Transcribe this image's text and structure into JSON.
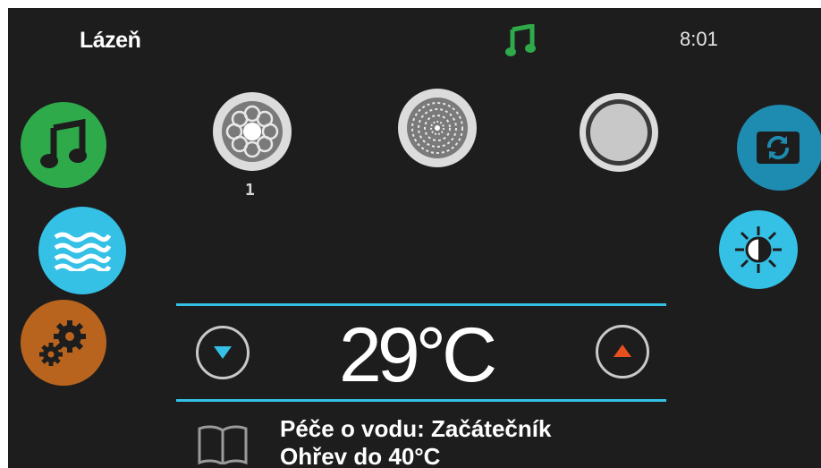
{
  "header": {
    "title": "Lázeň",
    "time": "8:01",
    "status_icon": "music-note-icon",
    "status_color": "#2eaa4a"
  },
  "left_menu": [
    {
      "icon": "music-icon",
      "color": "#2eaa4a"
    },
    {
      "icon": "water-waves-icon",
      "color": "#35c0e6"
    },
    {
      "icon": "gears-icon",
      "color": "#b8641e"
    }
  ],
  "right_menu": [
    {
      "icon": "refresh-icon",
      "color": "#1e8bb0"
    },
    {
      "icon": "brightness-icon",
      "color": "#35c0e6"
    }
  ],
  "jets": [
    {
      "icon": "jet-pump-icon",
      "label": "1"
    },
    {
      "icon": "jet-blower-icon",
      "label": ""
    },
    {
      "icon": "jet-off-icon",
      "label": ""
    }
  ],
  "temperature": {
    "value": "29°C",
    "down_color": "#35c0e6",
    "up_color": "#e8501e",
    "line_color": "#35c0e6"
  },
  "info": {
    "icon": "book-icon",
    "line1": "Péče o vodu: Začátečník",
    "line2": "Ohřev do 40°C"
  }
}
